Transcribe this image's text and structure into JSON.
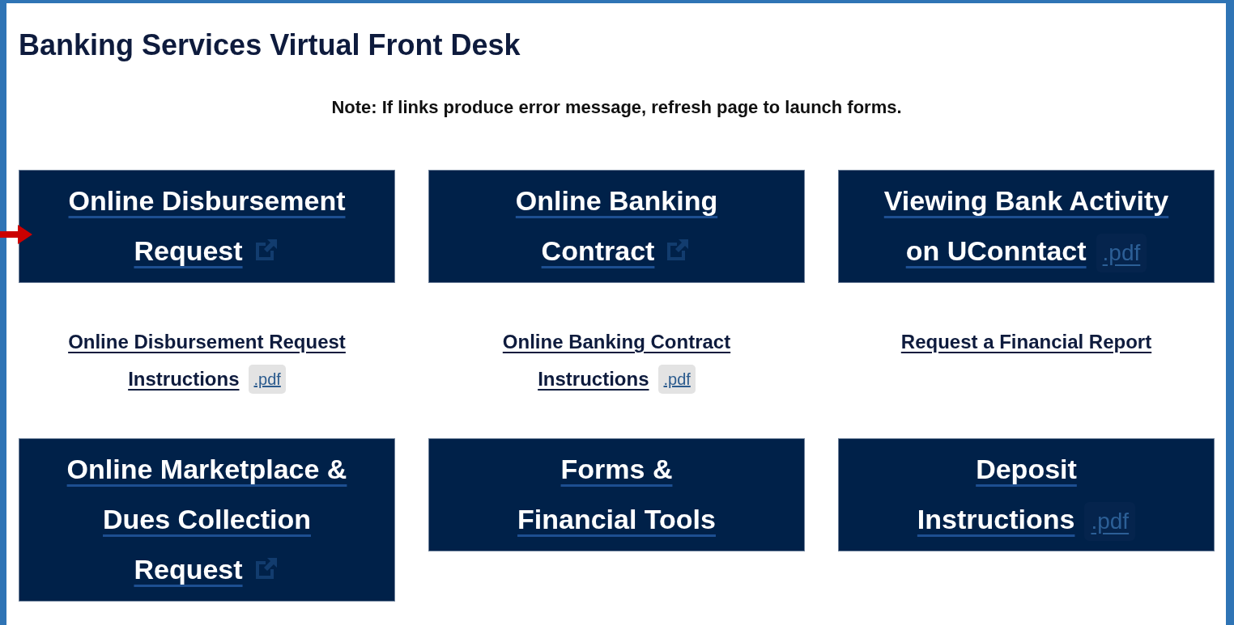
{
  "page": {
    "title": "Banking Services Virtual Front Desk",
    "note": "Note: If links produce error message, refresh page to launch forms."
  },
  "sections": [
    {
      "tiles": [
        {
          "title_lines": [
            "Online Disbursement",
            "Request"
          ],
          "badge": {
            "kind": "external"
          }
        },
        {
          "title_lines": [
            "Online Banking",
            "Contract"
          ],
          "badge": {
            "kind": "external"
          }
        },
        {
          "title_lines": [
            "Viewing Bank Activity",
            "on UConntact"
          ],
          "badge": {
            "kind": "pdf",
            "label": ".pdf"
          }
        }
      ],
      "links": [
        {
          "lines": [
            "Online Disbursement Request",
            "Instructions"
          ],
          "badge": {
            "kind": "pdf",
            "label": ".pdf"
          }
        },
        {
          "lines": [
            "Online Banking Contract",
            "Instructions"
          ],
          "badge": {
            "kind": "pdf",
            "label": ".pdf"
          }
        },
        {
          "lines": [
            "Request a Financial Report"
          ]
        }
      ]
    },
    {
      "tiles": [
        {
          "title_lines": [
            "Online Marketplace &",
            "Dues Collection",
            "Request"
          ],
          "badge": {
            "kind": "external"
          }
        },
        {
          "title_lines": [
            "Forms &",
            "Financial Tools"
          ]
        },
        {
          "title_lines": [
            "Deposit",
            "Instructions"
          ],
          "badge": {
            "kind": "pdf",
            "label": ".pdf"
          }
        }
      ]
    }
  ]
}
